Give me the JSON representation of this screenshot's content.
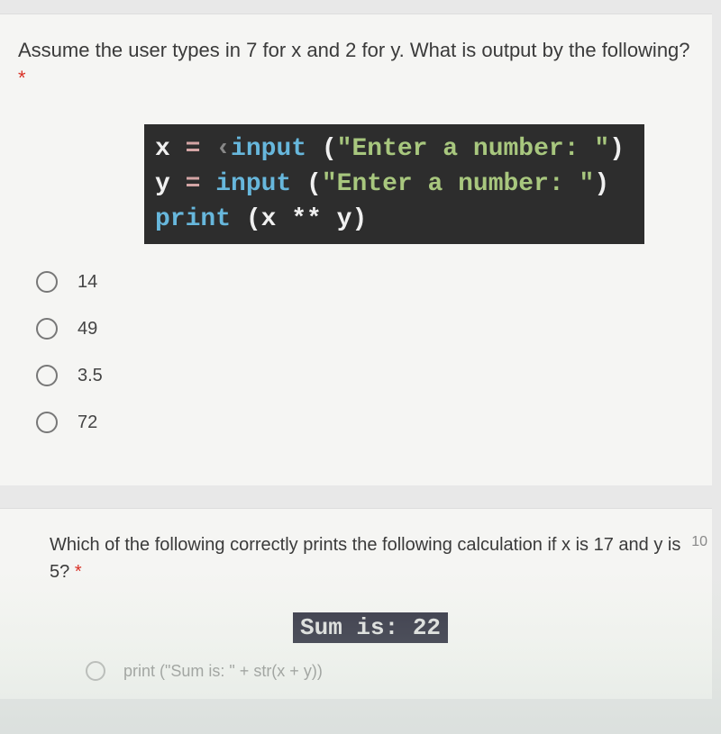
{
  "question1": {
    "text": "Assume the user types in 7 for x and 2 for y. What is output by the following? ",
    "required_marker": "*",
    "code": {
      "line1_var": "x ",
      "line1_eq": "= ",
      "line1_fn": "input ",
      "line1_paren_open": "(",
      "line1_str": "\"Enter a number: \"",
      "line1_paren_close": ")",
      "line2_var": "y ",
      "line2_eq": "= ",
      "line2_fn": "input ",
      "line2_paren_open": "(",
      "line2_str": "\"Enter a number: \"",
      "line2_paren_close": ")",
      "line3_fn": "print ",
      "line3_body": "(x ** y)"
    },
    "options": [
      "14",
      "49",
      "3.5",
      "72"
    ]
  },
  "question2": {
    "text": "Which of the following correctly prints the following calculation if x is 17 and y is 5? ",
    "required_marker": "*",
    "points": "10",
    "output_label": "Sum is: 22",
    "option1": "print (\"Sum is: \" + str(x + y))"
  }
}
